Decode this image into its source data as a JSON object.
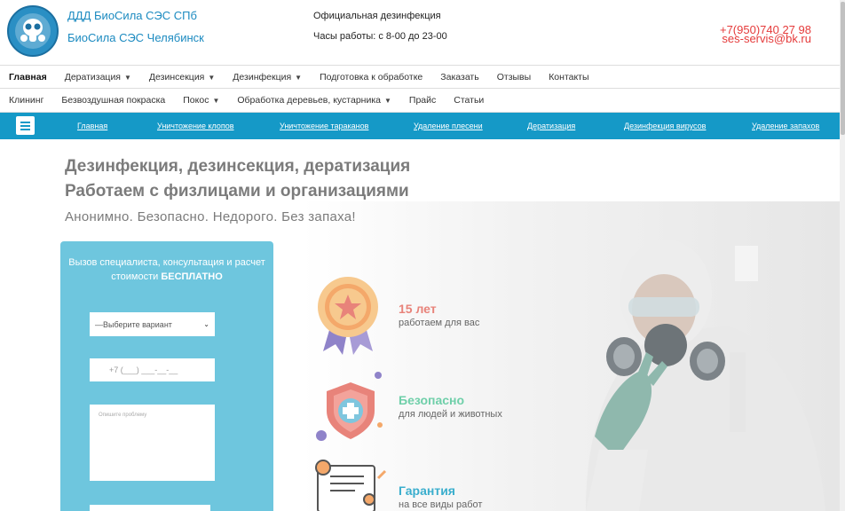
{
  "header": {
    "brand_spb": "ДДД БиоСила СЭС СПб",
    "brand_chel": "БиоСила СЭС Челябинск",
    "official": "Официальная дезинфекция",
    "hours": "Часы работы: с 8-00 до 23-00",
    "phone": "+7(950)740 27 98",
    "email": "ses-servis@bk.ru"
  },
  "menu1": [
    {
      "label": "Главная",
      "dropdown": false,
      "active": true
    },
    {
      "label": "Дератизация",
      "dropdown": true
    },
    {
      "label": "Дезинсекция",
      "dropdown": true
    },
    {
      "label": "Дезинфекция",
      "dropdown": true
    },
    {
      "label": "Подготовка к обработке",
      "dropdown": false
    },
    {
      "label": "Заказать",
      "dropdown": false
    },
    {
      "label": "Отзывы",
      "dropdown": false
    },
    {
      "label": "Контакты",
      "dropdown": false
    }
  ],
  "menu2": [
    {
      "label": "Клининг",
      "dropdown": false
    },
    {
      "label": "Безвоздушная покраска",
      "dropdown": false
    },
    {
      "label": "Покос",
      "dropdown": true
    },
    {
      "label": "Обработка деревьев, кустарника",
      "dropdown": true
    },
    {
      "label": "Прайс",
      "dropdown": false
    },
    {
      "label": "Статьи",
      "dropdown": false
    }
  ],
  "bluebar": [
    "Главная",
    "Уничтожение клопов",
    "Уничтожение тараканов",
    "Удаление плесени",
    "Дератизация",
    "Дезинфекция вирусов",
    "Удаление запахов"
  ],
  "hero": {
    "title1": "Дезинфекция, дезинсекция, дератизация",
    "title2": "Работаем с физлицами и организациями",
    "subtitle": "Анонимно. Безопасно. Недорого. Без запаха!"
  },
  "form": {
    "heading": "Вызов специалиста, консультация и расчет стоимости",
    "heading_bold": "БЕСПЛАТНО",
    "select_value": "—Выберите вариант",
    "phone_placeholder": "+7 (___) ___-__-__",
    "problem_placeholder": "Опишите проблему"
  },
  "features": [
    {
      "title": "15 лет",
      "subtitle": "работаем для вас",
      "color": "#e8837a"
    },
    {
      "title": "Безопасно",
      "subtitle": "для людей и животных",
      "color": "#6fcfa9"
    },
    {
      "title": "Гарантия",
      "subtitle": "на все виды работ",
      "color": "#3aaecd"
    }
  ],
  "colors": {
    "brand_blue": "#1599c7",
    "form_bg": "#6ec6de",
    "phone_red": "#e53b3b"
  }
}
